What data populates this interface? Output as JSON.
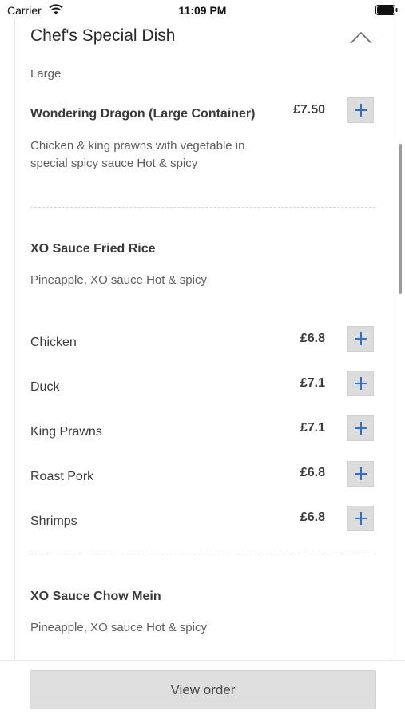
{
  "status_bar": {
    "carrier": "Carrier",
    "time": "11:09 PM"
  },
  "section": {
    "title": "Chef's Special Dish",
    "size_label": "Large"
  },
  "dishes": [
    {
      "name": "Wondering Dragon (Large Container)",
      "price": "£7.50",
      "description": "Chicken & king prawns with vegetable in special spicy sauce Hot & spicy"
    },
    {
      "name": "XO Sauce Fried Rice",
      "description": "Pineapple, XO sauce Hot & spicy",
      "options": [
        {
          "label": "Chicken",
          "price": "£6.8"
        },
        {
          "label": "Duck",
          "price": "£7.1"
        },
        {
          "label": "King Prawns",
          "price": "£7.1"
        },
        {
          "label": "Roast Pork",
          "price": "£6.8"
        },
        {
          "label": "Shrimps",
          "price": "£6.8"
        }
      ]
    },
    {
      "name": "XO Sauce Chow Mein",
      "description": "Pineapple, XO sauce Hot & spicy"
    }
  ],
  "footer": {
    "view_order_label": "View order"
  },
  "colors": {
    "add_icon": "#2f6fd0",
    "add_button_bg": "#dcdcdc",
    "view_order_bg": "#dedede"
  },
  "icons": {
    "collapse": "chevron-up-icon",
    "add": "plus-icon",
    "wifi": "wifi-icon",
    "battery": "battery-icon"
  }
}
